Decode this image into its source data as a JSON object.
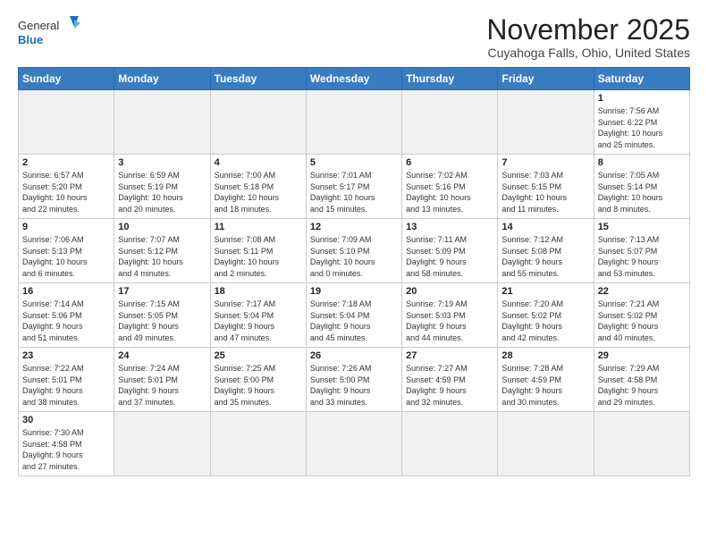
{
  "header": {
    "logo_general": "General",
    "logo_blue": "Blue",
    "month": "November 2025",
    "location": "Cuyahoga Falls, Ohio, United States"
  },
  "days_of_week": [
    "Sunday",
    "Monday",
    "Tuesday",
    "Wednesday",
    "Thursday",
    "Friday",
    "Saturday"
  ],
  "weeks": [
    [
      {
        "day": "",
        "info": ""
      },
      {
        "day": "",
        "info": ""
      },
      {
        "day": "",
        "info": ""
      },
      {
        "day": "",
        "info": ""
      },
      {
        "day": "",
        "info": ""
      },
      {
        "day": "",
        "info": ""
      },
      {
        "day": "1",
        "info": "Sunrise: 7:56 AM\nSunset: 6:22 PM\nDaylight: 10 hours\nand 25 minutes."
      }
    ],
    [
      {
        "day": "2",
        "info": "Sunrise: 6:57 AM\nSunset: 5:20 PM\nDaylight: 10 hours\nand 22 minutes."
      },
      {
        "day": "3",
        "info": "Sunrise: 6:59 AM\nSunset: 5:19 PM\nDaylight: 10 hours\nand 20 minutes."
      },
      {
        "day": "4",
        "info": "Sunrise: 7:00 AM\nSunset: 5:18 PM\nDaylight: 10 hours\nand 18 minutes."
      },
      {
        "day": "5",
        "info": "Sunrise: 7:01 AM\nSunset: 5:17 PM\nDaylight: 10 hours\nand 15 minutes."
      },
      {
        "day": "6",
        "info": "Sunrise: 7:02 AM\nSunset: 5:16 PM\nDaylight: 10 hours\nand 13 minutes."
      },
      {
        "day": "7",
        "info": "Sunrise: 7:03 AM\nSunset: 5:15 PM\nDaylight: 10 hours\nand 11 minutes."
      },
      {
        "day": "8",
        "info": "Sunrise: 7:05 AM\nSunset: 5:14 PM\nDaylight: 10 hours\nand 8 minutes."
      }
    ],
    [
      {
        "day": "9",
        "info": "Sunrise: 7:06 AM\nSunset: 5:13 PM\nDaylight: 10 hours\nand 6 minutes."
      },
      {
        "day": "10",
        "info": "Sunrise: 7:07 AM\nSunset: 5:12 PM\nDaylight: 10 hours\nand 4 minutes."
      },
      {
        "day": "11",
        "info": "Sunrise: 7:08 AM\nSunset: 5:11 PM\nDaylight: 10 hours\nand 2 minutes."
      },
      {
        "day": "12",
        "info": "Sunrise: 7:09 AM\nSunset: 5:10 PM\nDaylight: 10 hours\nand 0 minutes."
      },
      {
        "day": "13",
        "info": "Sunrise: 7:11 AM\nSunset: 5:09 PM\nDaylight: 9 hours\nand 58 minutes."
      },
      {
        "day": "14",
        "info": "Sunrise: 7:12 AM\nSunset: 5:08 PM\nDaylight: 9 hours\nand 55 minutes."
      },
      {
        "day": "15",
        "info": "Sunrise: 7:13 AM\nSunset: 5:07 PM\nDaylight: 9 hours\nand 53 minutes."
      }
    ],
    [
      {
        "day": "16",
        "info": "Sunrise: 7:14 AM\nSunset: 5:06 PM\nDaylight: 9 hours\nand 51 minutes."
      },
      {
        "day": "17",
        "info": "Sunrise: 7:15 AM\nSunset: 5:05 PM\nDaylight: 9 hours\nand 49 minutes."
      },
      {
        "day": "18",
        "info": "Sunrise: 7:17 AM\nSunset: 5:04 PM\nDaylight: 9 hours\nand 47 minutes."
      },
      {
        "day": "19",
        "info": "Sunrise: 7:18 AM\nSunset: 5:04 PM\nDaylight: 9 hours\nand 45 minutes."
      },
      {
        "day": "20",
        "info": "Sunrise: 7:19 AM\nSunset: 5:03 PM\nDaylight: 9 hours\nand 44 minutes."
      },
      {
        "day": "21",
        "info": "Sunrise: 7:20 AM\nSunset: 5:02 PM\nDaylight: 9 hours\nand 42 minutes."
      },
      {
        "day": "22",
        "info": "Sunrise: 7:21 AM\nSunset: 5:02 PM\nDaylight: 9 hours\nand 40 minutes."
      }
    ],
    [
      {
        "day": "23",
        "info": "Sunrise: 7:22 AM\nSunset: 5:01 PM\nDaylight: 9 hours\nand 38 minutes."
      },
      {
        "day": "24",
        "info": "Sunrise: 7:24 AM\nSunset: 5:01 PM\nDaylight: 9 hours\nand 37 minutes."
      },
      {
        "day": "25",
        "info": "Sunrise: 7:25 AM\nSunset: 5:00 PM\nDaylight: 9 hours\nand 35 minutes."
      },
      {
        "day": "26",
        "info": "Sunrise: 7:26 AM\nSunset: 5:00 PM\nDaylight: 9 hours\nand 33 minutes."
      },
      {
        "day": "27",
        "info": "Sunrise: 7:27 AM\nSunset: 4:59 PM\nDaylight: 9 hours\nand 32 minutes."
      },
      {
        "day": "28",
        "info": "Sunrise: 7:28 AM\nSunset: 4:59 PM\nDaylight: 9 hours\nand 30 minutes."
      },
      {
        "day": "29",
        "info": "Sunrise: 7:29 AM\nSunset: 4:58 PM\nDaylight: 9 hours\nand 29 minutes."
      }
    ],
    [
      {
        "day": "30",
        "info": "Sunrise: 7:30 AM\nSunset: 4:58 PM\nDaylight: 9 hours\nand 27 minutes."
      },
      {
        "day": "",
        "info": ""
      },
      {
        "day": "",
        "info": ""
      },
      {
        "day": "",
        "info": ""
      },
      {
        "day": "",
        "info": ""
      },
      {
        "day": "",
        "info": ""
      },
      {
        "day": "",
        "info": ""
      }
    ]
  ]
}
